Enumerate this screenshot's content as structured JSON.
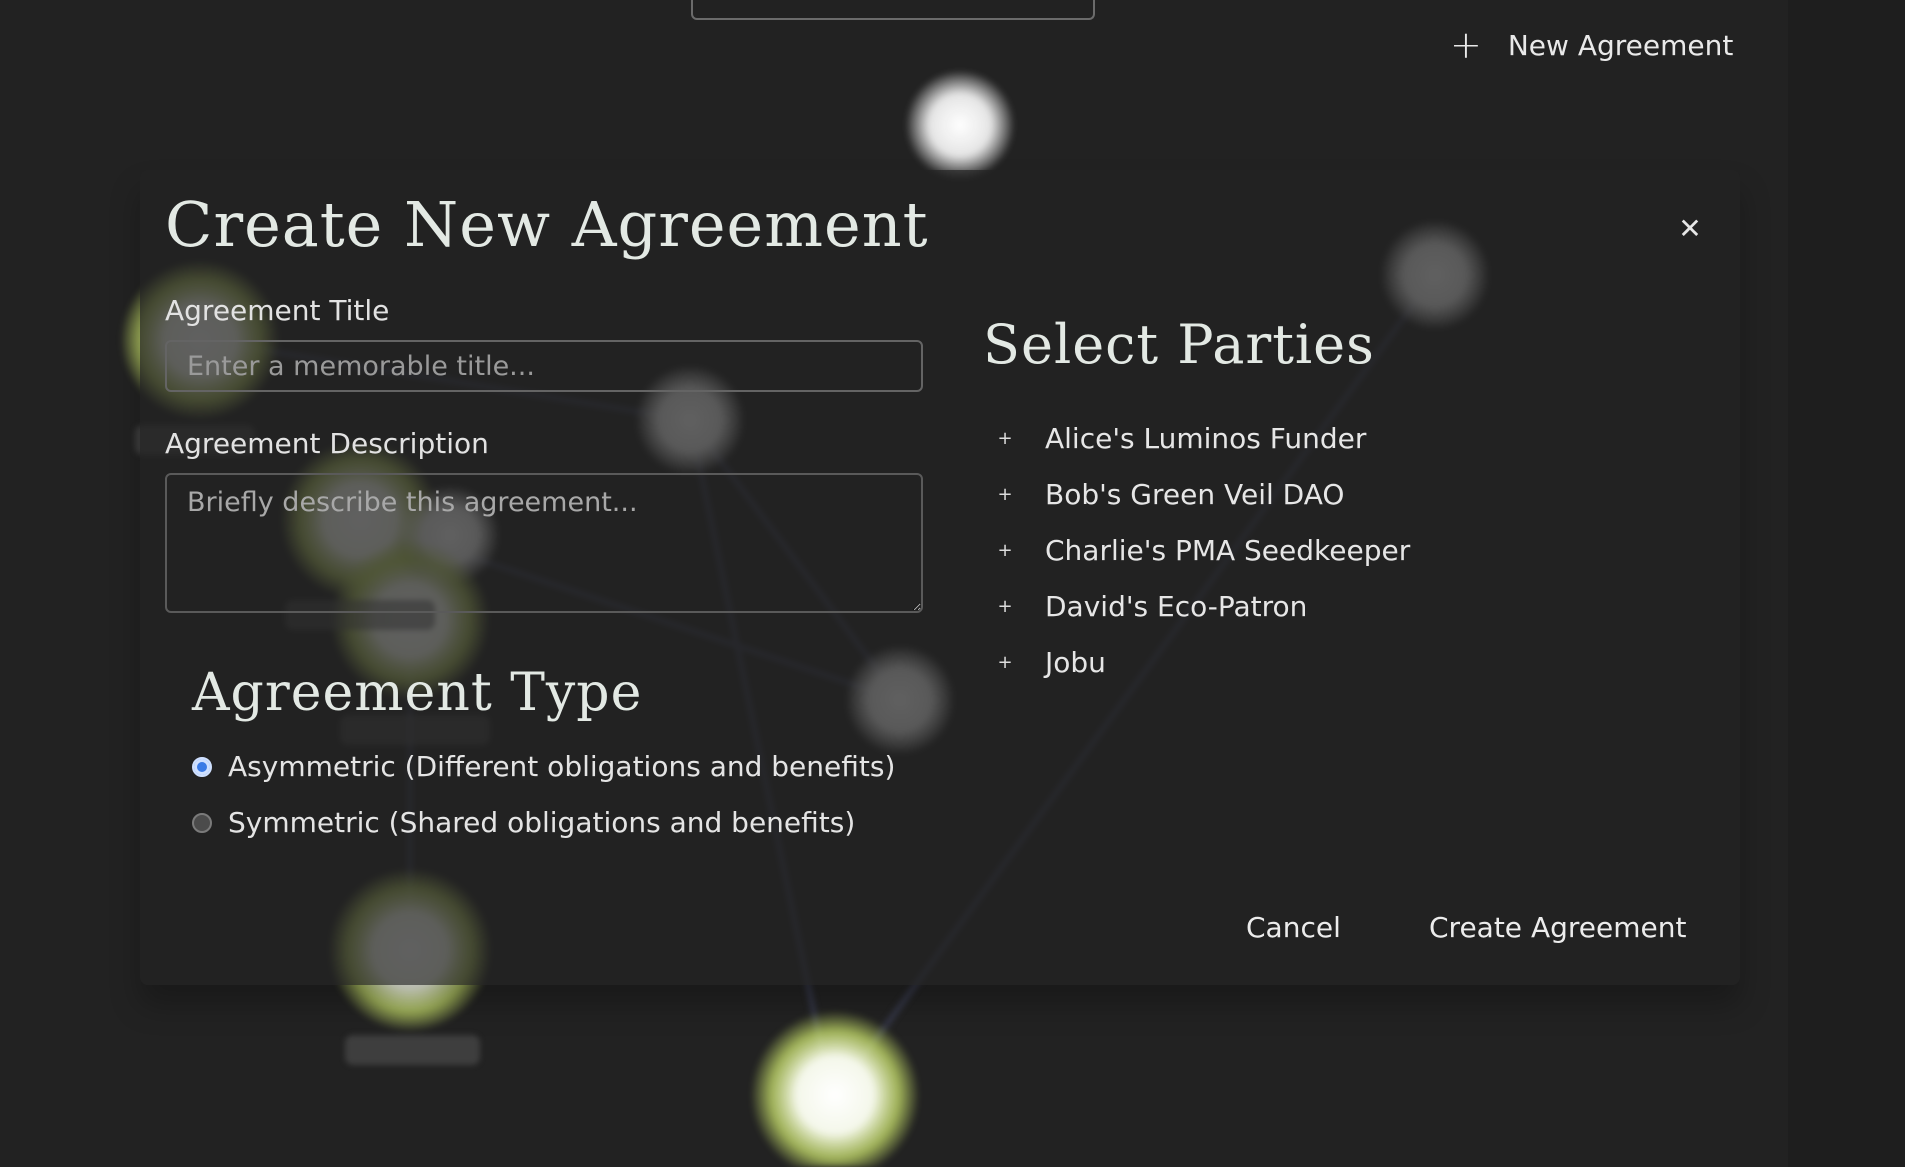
{
  "header": {
    "new_agreement_label": "New Agreement",
    "new_agreement_icon": "plus-icon"
  },
  "modal": {
    "title": "Create New Agreement",
    "close_icon": "close-icon",
    "title_field": {
      "label": "Agreement Title",
      "placeholder": "Enter a memorable title...",
      "value": ""
    },
    "description_field": {
      "label": "Agreement Description",
      "placeholder": "Briefly describe this agreement...",
      "value": ""
    },
    "agreement_type": {
      "heading": "Agreement Type",
      "options": [
        {
          "label": "Asymmetric (Different obligations and benefits)",
          "selected": true
        },
        {
          "label": "Symmetric (Shared obligations and benefits)",
          "selected": false
        }
      ]
    },
    "parties": {
      "heading": "Select Parties",
      "items": [
        {
          "label": "Alice's Luminos Funder"
        },
        {
          "label": "Bob's Green Veil DAO"
        },
        {
          "label": "Charlie's PMA Seedkeeper"
        },
        {
          "label": "David's Eco-Patron"
        },
        {
          "label": "Jobu"
        }
      ]
    },
    "footer": {
      "cancel_label": "Cancel",
      "create_label": "Create Agreement"
    }
  },
  "colors": {
    "background": "#222222",
    "node_glow": "#c8e06a",
    "radio_accent": "#3b7be6"
  }
}
